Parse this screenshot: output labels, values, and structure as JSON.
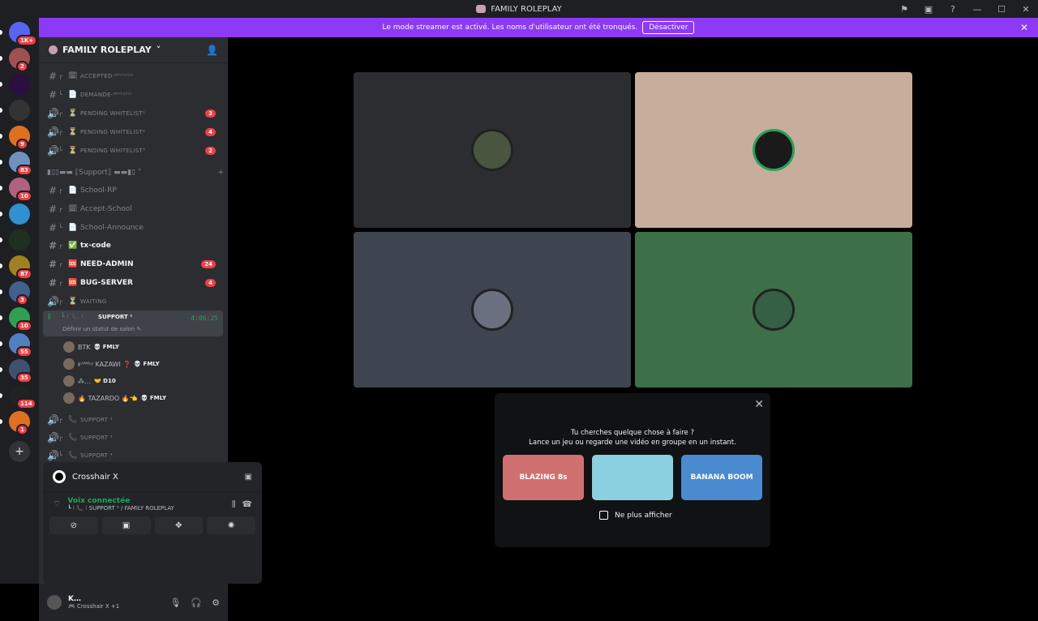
{
  "window": {
    "title": "FAMILY ROLEPLAY"
  },
  "banner": {
    "text": "Le mode streamer est activé. Les noms d'utilisateur ont été tronqués.",
    "button": "Désactiver"
  },
  "servers": [
    {
      "badge": "1K+",
      "color": "#5865f2"
    },
    {
      "badge": "2",
      "color": "#a05050"
    },
    {
      "badge": "",
      "color": "#2a1040"
    },
    {
      "badge": "",
      "color": "#333"
    },
    {
      "badge": "9",
      "color": "#e07020"
    },
    {
      "badge": "83",
      "color": "#7090c0"
    },
    {
      "badge": "10",
      "color": "#b06080"
    },
    {
      "badge": "",
      "color": "#3090d0"
    },
    {
      "badge": "",
      "color": "#203020"
    },
    {
      "badge": "87",
      "color": "#a08020"
    },
    {
      "badge": "3",
      "color": "#406090"
    },
    {
      "badge": "10",
      "color": "#30a050"
    },
    {
      "badge": "55",
      "color": "#5080c0"
    },
    {
      "badge": "35",
      "color": "#405070"
    },
    {
      "badge": "114",
      "color": "#222"
    },
    {
      "badge": "1",
      "color": "#e07020"
    }
  ],
  "server": {
    "name": "FAMILY ROLEPLAY"
  },
  "channels": [
    {
      "icon": "#",
      "tree": "┌",
      "emoji": "🗓",
      "name": "ACCEPTED-ᵂʰⁱᵗᵉˡⁱˢᵗ",
      "small": true,
      "count": ""
    },
    {
      "icon": "#",
      "tree": "└",
      "emoji": "📄",
      "name": "DEMANDE-ᵂʰⁱᵗᵉˡⁱˢᵗ",
      "small": true,
      "count": ""
    },
    {
      "icon": "🔊",
      "tree": "┌",
      "emoji": "⏳",
      "name": "PENDING WHITELIST¹",
      "small": true,
      "count": "3"
    },
    {
      "icon": "🔊",
      "tree": "┌",
      "emoji": "⏳",
      "name": "PENDING WHITELIST²",
      "small": true,
      "count": "4"
    },
    {
      "icon": "🔊",
      "tree": "└",
      "emoji": "⏳",
      "name": "PENDING WHITELIST³",
      "small": true,
      "count": "2"
    },
    {
      "icon": "#",
      "tree": "┌",
      "emoji": "📄",
      "name": "School-RP",
      "small": false,
      "count": ""
    },
    {
      "icon": "#",
      "tree": "┌",
      "emoji": "🗓",
      "name": "Accept-School",
      "small": false,
      "count": ""
    },
    {
      "icon": "#",
      "tree": "└",
      "emoji": "📄",
      "name": "School-Announce",
      "small": false,
      "count": ""
    },
    {
      "icon": "#",
      "tree": "┌",
      "emoji": "✅",
      "name": "tx-code",
      "small": false,
      "count": "",
      "bold": true
    },
    {
      "icon": "#",
      "tree": "┌",
      "emoji": "🆘",
      "name": "NEED-ADMIN",
      "small": false,
      "count": "24",
      "bold": true
    },
    {
      "icon": "#",
      "tree": "┌",
      "emoji": "🆘",
      "name": "BUG-SERVER",
      "small": false,
      "count": "4",
      "bold": true
    },
    {
      "icon": "🔊",
      "tree": "┌",
      "emoji": "⏳",
      "name": "WAITING",
      "small": true,
      "count": ""
    }
  ],
  "category": {
    "label": "▮▯▯▬▬ ⟦Support⟧ ▬▬▮▯ ˅",
    "plus": "+"
  },
  "voice": {
    "name": "SUPPORT ¹",
    "timer": "4:06:25",
    "status": "Définir un statut de salon ✎",
    "users": [
      {
        "name": "BTK",
        "tag": "💀 FMLY"
      },
      {
        "name": "ꜰᴬᴹᴵᴸʸ KAZAWI ❓",
        "tag": "💀 FMLY"
      },
      {
        "name": "⁂…",
        "tag": "🤝 D10"
      },
      {
        "name": "🔥 TAZARDO 🔥👈",
        "tag": "💀 FMLY"
      }
    ]
  },
  "voice_more": [
    "SUPPORT ²",
    "SUPPORT ³",
    "SUPPORT ⁴"
  ],
  "activity": {
    "name": "Crosshair X"
  },
  "connection": {
    "status": "Voix connectée",
    "path": "┗ ⁝ 📞 ⁝ SUPPORT ¹ / FAMILY ROLEPLAY"
  },
  "user": {
    "name": "K…",
    "status": "🎮 Crosshair X +1"
  },
  "tiles": [
    {
      "bg": "#2b2d31"
    },
    {
      "bg": "#c8ad9c"
    },
    {
      "bg": "#3e4550"
    },
    {
      "bg": "#3d7048"
    }
  ],
  "popup": {
    "line1": "Tu cherches quelque chose à faire ?",
    "line2": "Lance un jeu ou regarde une vidéo en groupe en un instant.",
    "checkbox": "Ne plus afficher",
    "games": [
      {
        "name": "BLAZING 8s",
        "bg": "#d07070"
      },
      {
        "name": "",
        "bg": "#8ad0e0"
      },
      {
        "name": "BANANA BOOM",
        "bg": "#4a8ad0"
      }
    ]
  }
}
